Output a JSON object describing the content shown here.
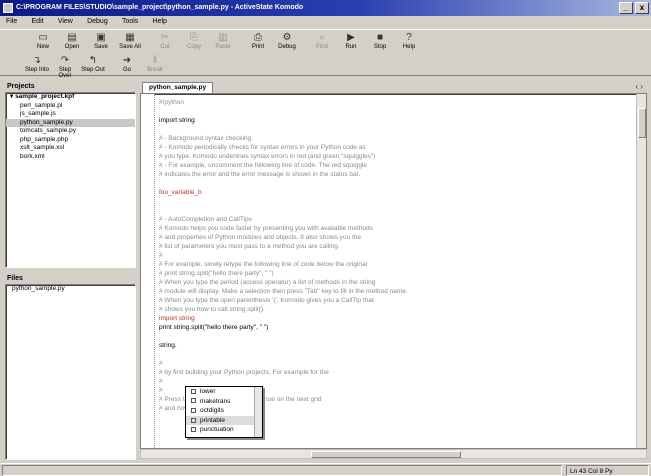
{
  "window": {
    "title": "C:\\PROGRAM FILES\\STUDIO\\sample_project\\python_sample.py - ActiveState Komodo",
    "buttons": [
      "_",
      "x"
    ]
  },
  "menu": [
    "File",
    "Edit",
    "View",
    "Debug",
    "Tools",
    "Help"
  ],
  "toolbar1": [
    {
      "label": "New",
      "icon": "new-file-icon",
      "glyph": "▭",
      "enabled": true
    },
    {
      "label": "Open",
      "icon": "open-icon",
      "glyph": "▤",
      "enabled": true
    },
    {
      "label": "Save",
      "icon": "save-icon",
      "glyph": "▣",
      "enabled": true
    },
    {
      "label": "Save All",
      "icon": "save-all-icon",
      "glyph": "▦",
      "enabled": true
    },
    {
      "label": "Cut",
      "icon": "cut-icon",
      "glyph": "✂",
      "enabled": false
    },
    {
      "label": "Copy",
      "icon": "copy-icon",
      "glyph": "⎘",
      "enabled": false
    },
    {
      "label": "Paste",
      "icon": "paste-icon",
      "glyph": "▥",
      "enabled": false
    },
    {
      "label": "Print",
      "icon": "print-icon",
      "glyph": "⎙",
      "enabled": true
    },
    {
      "label": "Debug",
      "icon": "debug-icon",
      "glyph": "⚙",
      "enabled": true
    },
    {
      "label": "Find",
      "icon": "find-icon",
      "glyph": "⌕",
      "enabled": false
    },
    {
      "label": "Run",
      "icon": "run-icon",
      "glyph": "▶",
      "enabled": true
    },
    {
      "label": "Stop",
      "icon": "stop-icon",
      "glyph": "■",
      "enabled": true
    },
    {
      "label": "Help",
      "icon": "help-icon",
      "glyph": "?",
      "enabled": true
    }
  ],
  "toolbar2": [
    {
      "label": "Step Into",
      "icon": "step-into-icon",
      "glyph": "↴",
      "enabled": true
    },
    {
      "label": "Step Over",
      "icon": "step-over-icon",
      "glyph": "↷",
      "enabled": true
    },
    {
      "label": "Step Out",
      "icon": "step-out-icon",
      "glyph": "↰",
      "enabled": true
    },
    {
      "label": "Go",
      "icon": "go-icon",
      "glyph": "➜",
      "enabled": true
    },
    {
      "label": "Break",
      "icon": "break-icon",
      "glyph": "‖",
      "enabled": false
    }
  ],
  "projects": {
    "title": "Projects",
    "items": [
      {
        "label": "sample_project.kpf",
        "root": true,
        "selected": false
      },
      {
        "label": "perl_sample.pl",
        "root": false,
        "selected": false
      },
      {
        "label": "js_sample.js",
        "root": false,
        "selected": false
      },
      {
        "label": "python_sample.py",
        "root": false,
        "selected": true
      },
      {
        "label": "tomcats_sample.py",
        "root": false,
        "selected": false
      },
      {
        "label": "php_sample.php",
        "root": false,
        "selected": false
      },
      {
        "label": "xslt_sample.xsl",
        "root": false,
        "selected": false
      },
      {
        "label": "bork.xml",
        "root": false,
        "selected": false
      }
    ]
  },
  "files": {
    "title": "Files",
    "items": [
      {
        "label": "python_sample.py",
        "selected": false
      }
    ]
  },
  "editor": {
    "tab_label": "python_sample.py",
    "nav_arrows": "‹ ›",
    "lines": [
      {
        "t": "#!python",
        "s": "c"
      },
      {
        "t": "",
        "s": "blank"
      },
      {
        "t": "import string",
        "s": "k"
      },
      {
        "t": "",
        "s": "blank"
      },
      {
        "t": "#  - Background syntax checking:",
        "s": "c"
      },
      {
        "t": "#    - Komodo periodically checks for syntax errors in your Python code as",
        "s": "c"
      },
      {
        "t": "#      you type. Komodo underlines syntax errors in red (and green \"squiggles\")",
        "s": "c"
      },
      {
        "t": "#    - For example, uncomment the following line of code. The red squiggle",
        "s": "c"
      },
      {
        "t": "#      indicates the error and the error message is shown in the status bar.",
        "s": "c"
      },
      {
        "t": "",
        "s": "blank"
      },
      {
        "t": "foo_variable_b",
        "s": "r"
      },
      {
        "t": "",
        "s": "blank"
      },
      {
        "t": "",
        "s": "blank"
      },
      {
        "t": "#  - AutoCompletion and CallTips",
        "s": "c"
      },
      {
        "t": "#    Komodo helps you code faster by presenting you with available methods",
        "s": "c"
      },
      {
        "t": "#    and properties of Python modules and objects. It also shows you the",
        "s": "c"
      },
      {
        "t": "#    list of parameters you must pass to a method you are calling.",
        "s": "c"
      },
      {
        "t": "#",
        "s": "c"
      },
      {
        "t": "#    For example, slowly retype the following line of code below the original",
        "s": "c"
      },
      {
        "t": "#        print string.split(\"hello there party\", \" \")",
        "s": "c"
      },
      {
        "t": "#    When you type the period (access operator) a list of methods in the string",
        "s": "c"
      },
      {
        "t": "#    module will display. Make a selection then press \"Tab\" key to fill in the method name.",
        "s": "c"
      },
      {
        "t": "#    When you type the open parenthesis '(', Komodo gives you a CallTip that",
        "s": "c"
      },
      {
        "t": "#    shows you how to call string.split().",
        "s": "c"
      },
      {
        "t": "import string",
        "s": "r"
      },
      {
        "t": "print string.split(\"hello there party\", \" \")",
        "s": "k"
      },
      {
        "t": "",
        "s": "blank"
      },
      {
        "t": "string.",
        "s": "k"
      },
      {
        "t": "",
        "s": "blank"
      },
      {
        "t": "#",
        "s": "c"
      },
      {
        "t": "#        by first building your Python projects. For example for the",
        "s": "c"
      },
      {
        "t": "#",
        "s": "c"
      },
      {
        "t": "#",
        "s": "c"
      },
      {
        "t": "#    Press the 'Tab' or 'Esc' key to continue on the next grid",
        "s": "c"
      },
      {
        "t": "#        and how to the left",
        "s": "c"
      }
    ]
  },
  "autocomplete": {
    "items": [
      "lower",
      "maketrans",
      "octdigits",
      "printable",
      "punctuation"
    ],
    "selected_index": 3
  },
  "status": {
    "left": "",
    "right": "Ln 43 Col 8  Py"
  }
}
